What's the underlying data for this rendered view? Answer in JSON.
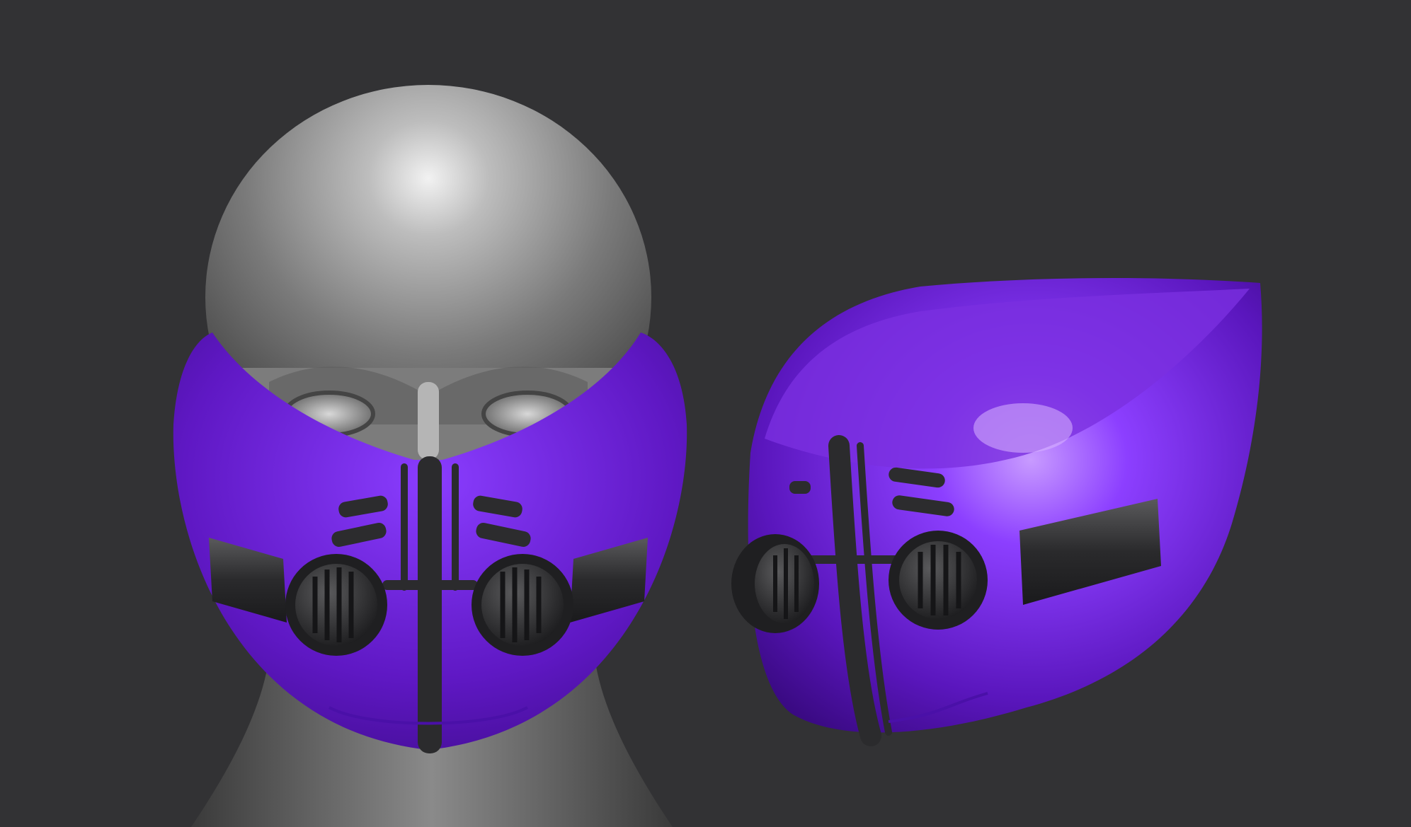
{
  "scene": {
    "background_color": "#323234",
    "materials": {
      "head_clay": "#8c8c8c",
      "mask_purple": "#6a1fd0",
      "mask_highlight": "#9f5cff",
      "trim_black": "#2c2c2e"
    },
    "objects": [
      {
        "name": "sculpted-head",
        "view": "front"
      },
      {
        "name": "respirator-mask",
        "view": "front"
      },
      {
        "name": "respirator-mask",
        "view": "three-quarter"
      }
    ]
  }
}
